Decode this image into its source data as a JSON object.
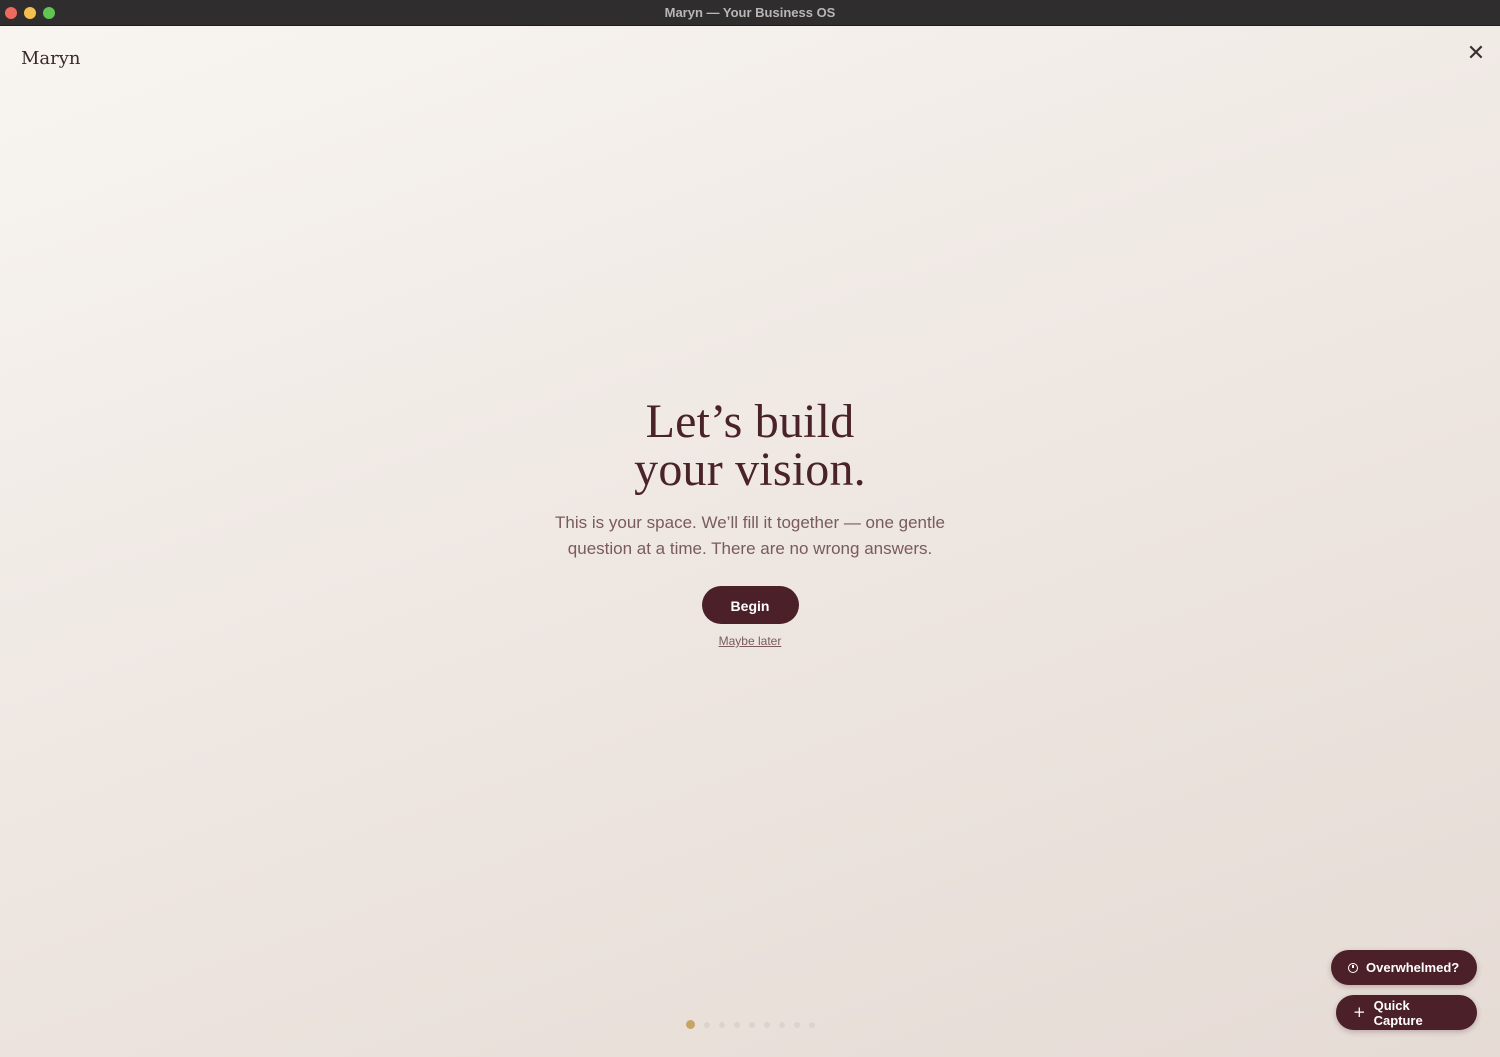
{
  "window": {
    "title": "Maryn — Your Business OS"
  },
  "header": {
    "brand": "Maryn",
    "close_icon": "close-icon"
  },
  "hero": {
    "headline_line1": "Let’s build",
    "headline_line2": "your vision.",
    "subtitle": "This is your space. We’ll fill it together — one gentle question at a time. There are no wrong answers.",
    "begin_label": "Begin",
    "maybe_later_label": "Maybe later"
  },
  "progress": {
    "total_steps": 9,
    "current_step": 1
  },
  "fabs": {
    "overwhelmed_label": "Overwhelmed?",
    "overwhelmed_icon": "clock-icon",
    "quick_capture_label": "Quick Capture",
    "quick_capture_icon": "plus-icon"
  },
  "colors": {
    "primary": "#4c2028",
    "accent_gold": "#c7a463",
    "text_muted": "#7a5a5f",
    "background": "#f3ece7"
  }
}
